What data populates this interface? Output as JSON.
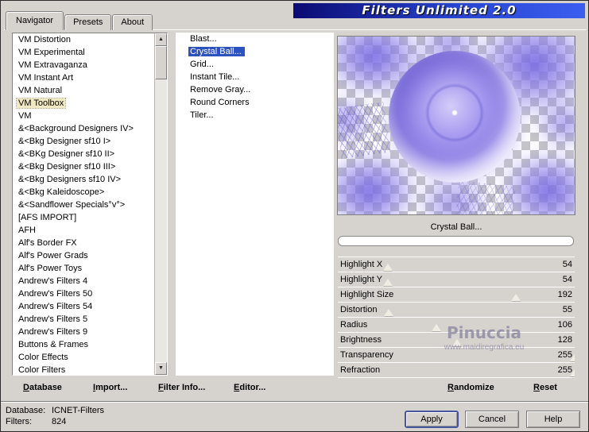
{
  "window": {
    "title": "Filters Unlimited 2.0"
  },
  "tabs": [
    {
      "label": "Navigator",
      "selected": true
    },
    {
      "label": "Presets"
    },
    {
      "label": "About"
    }
  ],
  "categories": {
    "items": [
      {
        "label": "VM Distortion"
      },
      {
        "label": "VM Experimental"
      },
      {
        "label": "VM Extravaganza"
      },
      {
        "label": "VM Instant Art"
      },
      {
        "label": "VM Natural"
      },
      {
        "label": "VM Toolbox",
        "selected": true
      },
      {
        "label": "VM"
      },
      {
        "label": "&<Background Designers IV>"
      },
      {
        "label": "&<Bkg Designer sf10 I>"
      },
      {
        "label": "&<BKg Designer sf10 II>"
      },
      {
        "label": "&<Bkg Designer sf10 III>"
      },
      {
        "label": "&<Bkg Designers sf10 IV>"
      },
      {
        "label": "&<Bkg Kaleidoscope>"
      },
      {
        "label": "&<Sandflower Specials°v°>"
      },
      {
        "label": "[AFS IMPORT]"
      },
      {
        "label": "AFH"
      },
      {
        "label": "Alf's Border FX"
      },
      {
        "label": "Alf's Power Grads"
      },
      {
        "label": "Alf's Power Toys"
      },
      {
        "label": "Andrew's Filters 4"
      },
      {
        "label": "Andrew's Filters 50"
      },
      {
        "label": "Andrew's Filters 54"
      },
      {
        "label": "Andrew's Filters 5"
      },
      {
        "label": "Andrew's Filters 9"
      },
      {
        "label": "Buttons & Frames"
      },
      {
        "label": "Color Effects"
      },
      {
        "label": "Color Filters"
      }
    ]
  },
  "filters": {
    "items": [
      {
        "label": "Blast..."
      },
      {
        "label": "Crystal Ball...",
        "selected": true
      },
      {
        "label": "Grid..."
      },
      {
        "label": "Instant Tile..."
      },
      {
        "label": "Remove Gray..."
      },
      {
        "label": "Round Corners"
      },
      {
        "label": "Tiler..."
      }
    ]
  },
  "preview": {
    "caption": "Crystal Ball..."
  },
  "params": {
    "items": [
      {
        "label": "Highlight X",
        "value": 54
      },
      {
        "label": "Highlight Y",
        "value": 54
      },
      {
        "label": "Highlight Size",
        "value": 192
      },
      {
        "label": "Distortion",
        "value": 55
      },
      {
        "label": "Radius",
        "value": 106
      },
      {
        "label": "Brightness",
        "value": 128
      },
      {
        "label": "Transparency",
        "value": 255
      },
      {
        "label": "Refraction",
        "value": 255
      }
    ]
  },
  "toolbar": {
    "database": "Database",
    "import": "Import...",
    "filter_info": "Filter Info...",
    "editor": "Editor...",
    "randomize": "Randomize",
    "reset": "Reset"
  },
  "watermark": {
    "line1": "Pinuccia",
    "line2": "www.maidiregrafica.eu"
  },
  "status": {
    "database_label": "Database:",
    "database_value": "ICNET-Filters",
    "filters_label": "Filters:",
    "filters_value": "824"
  },
  "actions": {
    "apply": "Apply",
    "cancel": "Cancel",
    "help": "Help"
  },
  "colors": {
    "selection_blue": "#2c52c0",
    "category_highlight": "#f1e9c3",
    "banner_gradient_start": "#0b0b72",
    "banner_gradient_end": "#3b5ef0",
    "dialog_gray": "#d6d3ce"
  }
}
